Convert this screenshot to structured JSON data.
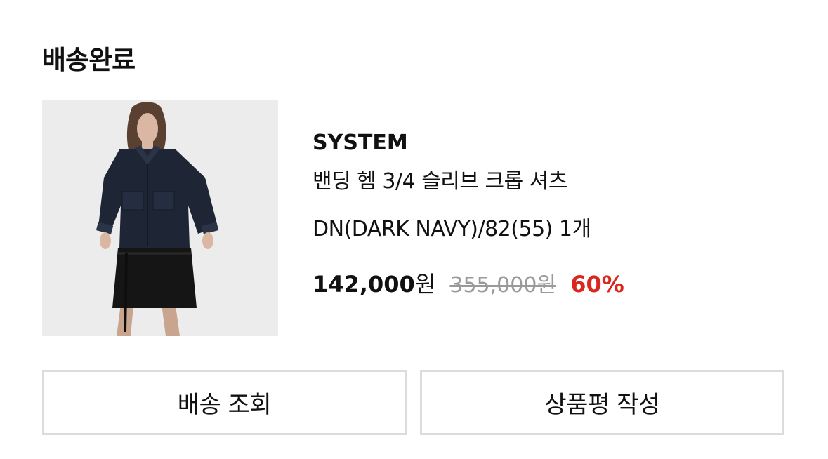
{
  "order": {
    "status": "배송완료"
  },
  "product": {
    "image_alt": "model wearing dark navy cropped shirt",
    "brand": "SYSTEM",
    "name": "밴딩 헴 3/4 슬리브 크롭 셔츠",
    "option": "DN(DARK NAVY)/82(55)  1개",
    "sale_price": "142,000",
    "sale_currency": "원",
    "original_price": "355,000원",
    "discount": "60%"
  },
  "actions": {
    "track_label": "배송 조회",
    "review_label": "상품평 작성"
  },
  "colors": {
    "discount": "#d9271e",
    "original_price": "#9a9a9a",
    "button_border": "#dcdcdc"
  }
}
